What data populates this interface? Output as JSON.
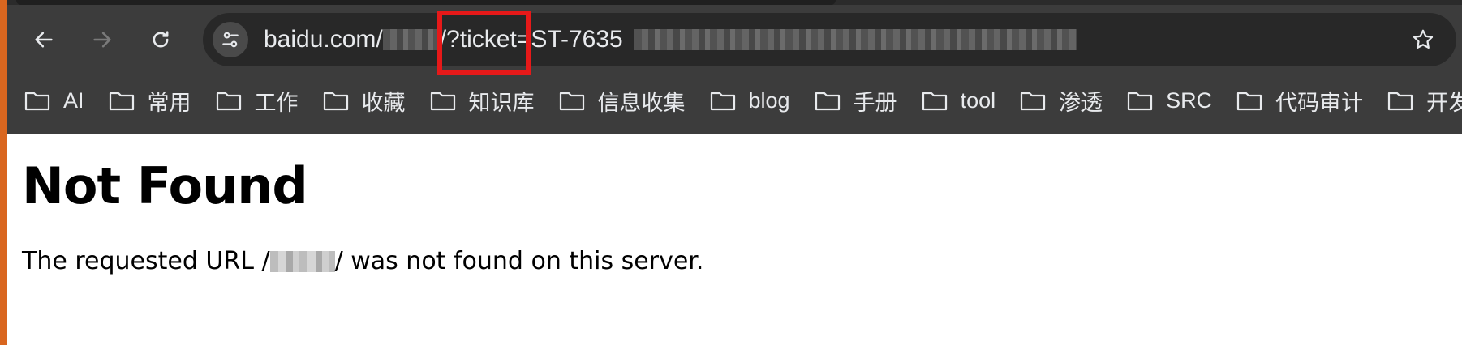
{
  "toolbar": {
    "back_icon": "arrow-left-icon",
    "forward_icon": "arrow-right-icon",
    "reload_icon": "reload-icon"
  },
  "omnibox": {
    "site_info_icon": "tune-icon",
    "url_prefix": "baidu.com/",
    "url_path_tail": "/",
    "url_query_key": "?ticket",
    "url_query_value": "=ST-7635",
    "bookmark_icon": "star-icon",
    "highlight_color": "#e61919"
  },
  "bookmarks": [
    {
      "label": "AI"
    },
    {
      "label": "常用"
    },
    {
      "label": "工作"
    },
    {
      "label": "收藏"
    },
    {
      "label": "知识库"
    },
    {
      "label": "信息收集"
    },
    {
      "label": "blog"
    },
    {
      "label": "手册"
    },
    {
      "label": "tool"
    },
    {
      "label": "渗透"
    },
    {
      "label": "SRC"
    },
    {
      "label": "代码审计"
    },
    {
      "label": "开发"
    }
  ],
  "page": {
    "heading": "Not Found",
    "message_start": "The requested URL /",
    "message_end": "/ was not found on this server."
  },
  "colors": {
    "toolbar_bg": "#3c3c3c",
    "omnibox_bg": "#282828",
    "accent_left": "#d9661f"
  }
}
